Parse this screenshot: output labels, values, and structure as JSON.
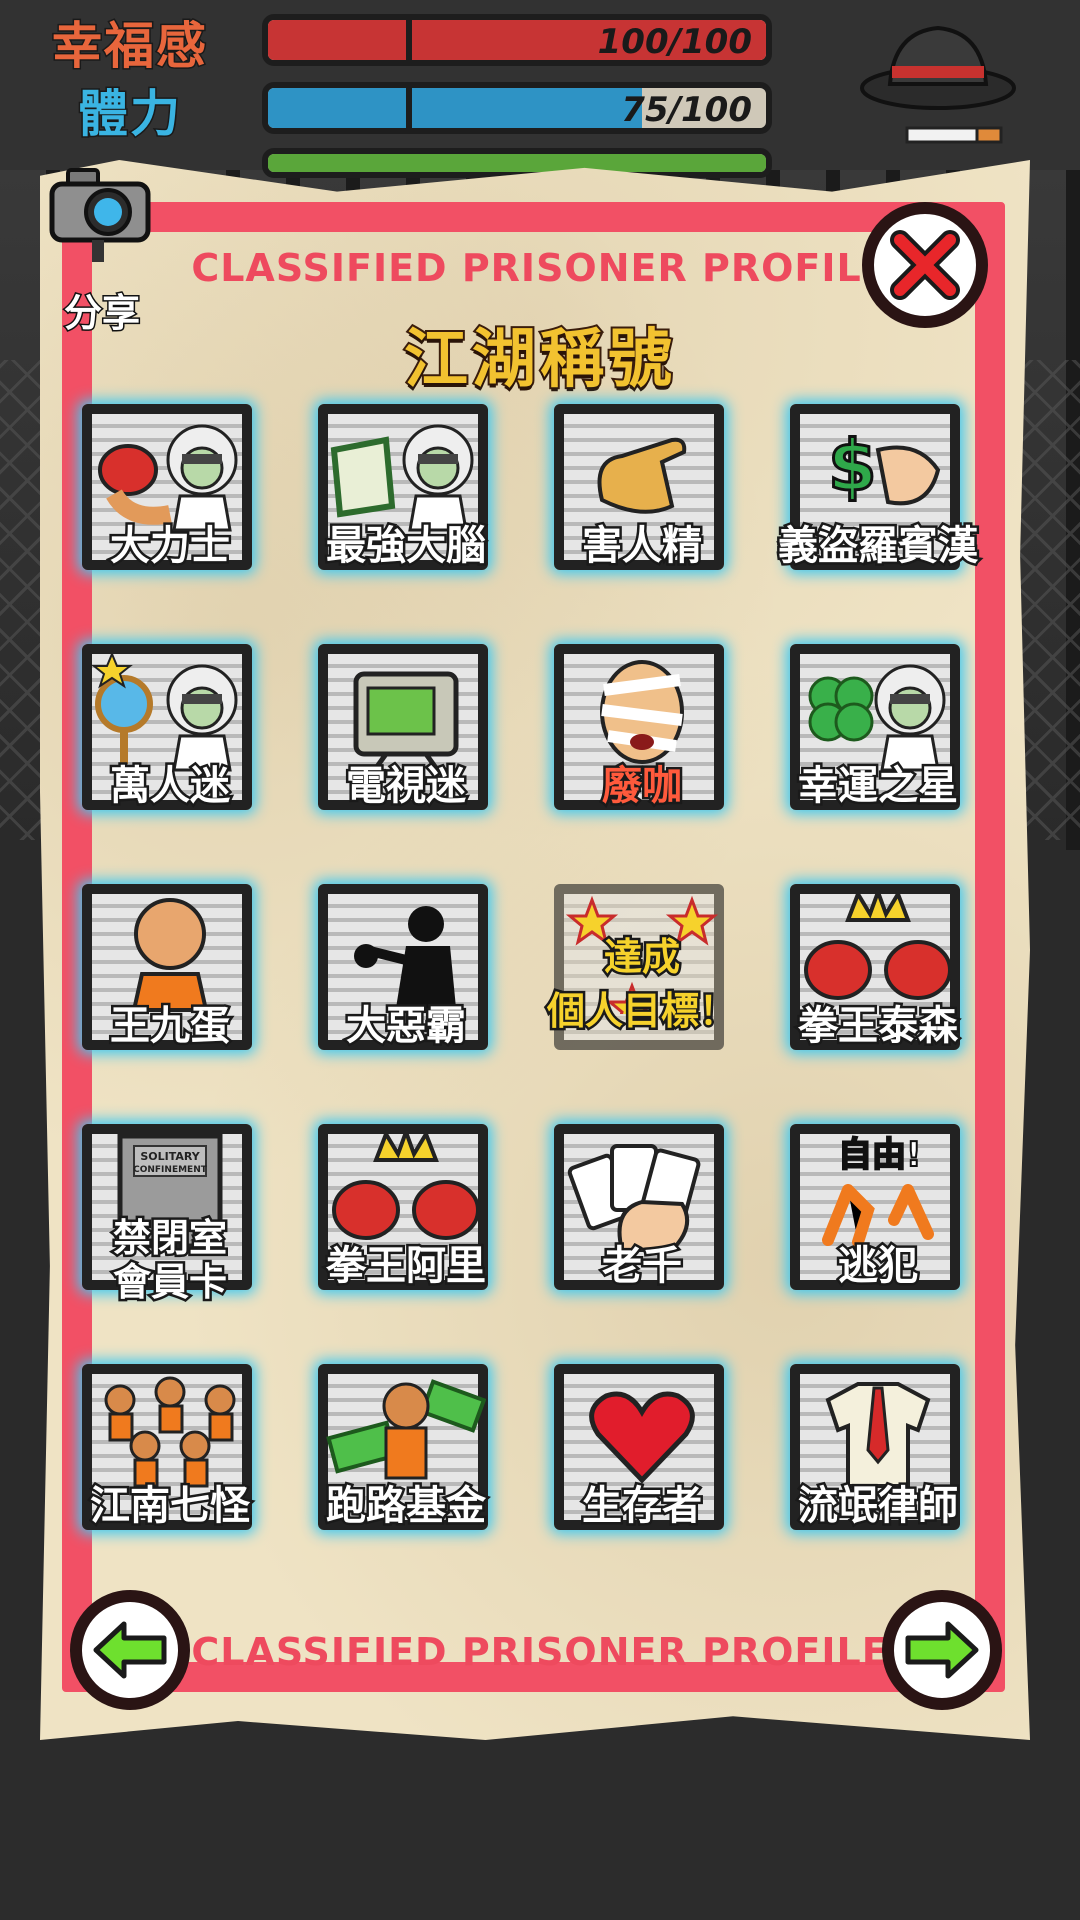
{
  "hud": {
    "stats": [
      {
        "label": "幸福感",
        "value": "100/100",
        "fill": 1.0,
        "color": "#c73434",
        "label_color": "#e05a3a"
      },
      {
        "label": "體力",
        "value": "75/100",
        "fill": 0.75,
        "color": "#2e93c5",
        "label_color": "#3ab4e2"
      }
    ]
  },
  "panel": {
    "header_banner": "CLASSIFIED PRISONER PROFILE",
    "footer_banner": "CLASSIFIED PRISONER PROFILE",
    "title": "江湖稱號",
    "share_label": "分享"
  },
  "badges": [
    {
      "label": "大力士",
      "icon": "boxing-glove-professor-icon"
    },
    {
      "label": "最強大腦",
      "icon": "book-professor-icon"
    },
    {
      "label": "害人精",
      "icon": "pointing-hand-icon"
    },
    {
      "label": "義盜羅賓漢",
      "icon": "dollar-hand-icon"
    },
    {
      "label": "萬人迷",
      "icon": "mirror-professor-icon"
    },
    {
      "label": "電視迷",
      "icon": "tv-icon"
    },
    {
      "label": "廢咖",
      "icon": "bandaged-face-icon",
      "red": true
    },
    {
      "label": "幸運之星",
      "icon": "clover-professor-icon"
    },
    {
      "label": "王九蛋",
      "icon": "bald-prisoner-icon"
    },
    {
      "label": "大惡霸",
      "icon": "bully-silhouette-icon"
    },
    {
      "label": "達成\n個人目標！",
      "icon": "goal-stars-icon",
      "goal": true
    },
    {
      "label": "拳王泰森",
      "icon": "crown-gloves-icon"
    },
    {
      "label": "禁閉室\n會員卡",
      "icon": "solitary-door-icon",
      "two": true
    },
    {
      "label": "拳王阿里",
      "icon": "crown-gloves-icon"
    },
    {
      "label": "老千",
      "icon": "playing-cards-icon"
    },
    {
      "label": "逃犯",
      "icon": "running-legs-icon"
    },
    {
      "label": "江南七怪",
      "icon": "prisoner-crowd-icon"
    },
    {
      "label": "跑路基金",
      "icon": "cash-prisoner-icon"
    },
    {
      "label": "生存者",
      "icon": "heart-bars-icon"
    },
    {
      "label": "流氓律師",
      "icon": "shirt-tie-icon"
    }
  ],
  "solitary_sign": "SOLITARY CONFINEMENT",
  "escape_sign": "自由!"
}
